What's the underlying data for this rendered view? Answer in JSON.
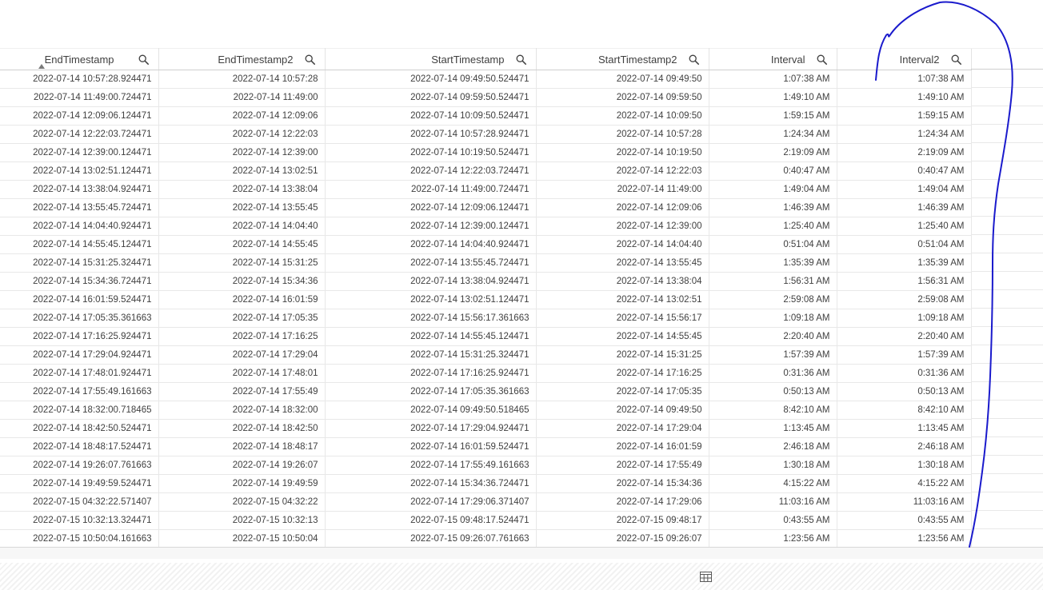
{
  "table": {
    "sort_column": "EndTimestamp",
    "sort_direction": "ascending",
    "columns": [
      {
        "label": "EndTimestamp",
        "icon": "search-icon"
      },
      {
        "label": "EndTimestamp2",
        "icon": "search-icon"
      },
      {
        "label": "StartTimestamp",
        "icon": "search-icon"
      },
      {
        "label": "StartTimestamp2",
        "icon": "search-icon"
      },
      {
        "label": "Interval",
        "icon": "search-icon"
      },
      {
        "label": "Interval2",
        "icon": "search-icon"
      }
    ],
    "rows": [
      [
        "2022-07-14 10:57:28.924471",
        "2022-07-14 10:57:28",
        "2022-07-14 09:49:50.524471",
        "2022-07-14 09:49:50",
        "1:07:38 AM",
        "1:07:38 AM"
      ],
      [
        "2022-07-14 11:49:00.724471",
        "2022-07-14 11:49:00",
        "2022-07-14 09:59:50.524471",
        "2022-07-14 09:59:50",
        "1:49:10 AM",
        "1:49:10 AM"
      ],
      [
        "2022-07-14 12:09:06.124471",
        "2022-07-14 12:09:06",
        "2022-07-14 10:09:50.524471",
        "2022-07-14 10:09:50",
        "1:59:15 AM",
        "1:59:15 AM"
      ],
      [
        "2022-07-14 12:22:03.724471",
        "2022-07-14 12:22:03",
        "2022-07-14 10:57:28.924471",
        "2022-07-14 10:57:28",
        "1:24:34 AM",
        "1:24:34 AM"
      ],
      [
        "2022-07-14 12:39:00.124471",
        "2022-07-14 12:39:00",
        "2022-07-14 10:19:50.524471",
        "2022-07-14 10:19:50",
        "2:19:09 AM",
        "2:19:09 AM"
      ],
      [
        "2022-07-14 13:02:51.124471",
        "2022-07-14 13:02:51",
        "2022-07-14 12:22:03.724471",
        "2022-07-14 12:22:03",
        "0:40:47 AM",
        "0:40:47 AM"
      ],
      [
        "2022-07-14 13:38:04.924471",
        "2022-07-14 13:38:04",
        "2022-07-14 11:49:00.724471",
        "2022-07-14 11:49:00",
        "1:49:04 AM",
        "1:49:04 AM"
      ],
      [
        "2022-07-14 13:55:45.724471",
        "2022-07-14 13:55:45",
        "2022-07-14 12:09:06.124471",
        "2022-07-14 12:09:06",
        "1:46:39 AM",
        "1:46:39 AM"
      ],
      [
        "2022-07-14 14:04:40.924471",
        "2022-07-14 14:04:40",
        "2022-07-14 12:39:00.124471",
        "2022-07-14 12:39:00",
        "1:25:40 AM",
        "1:25:40 AM"
      ],
      [
        "2022-07-14 14:55:45.124471",
        "2022-07-14 14:55:45",
        "2022-07-14 14:04:40.924471",
        "2022-07-14 14:04:40",
        "0:51:04 AM",
        "0:51:04 AM"
      ],
      [
        "2022-07-14 15:31:25.324471",
        "2022-07-14 15:31:25",
        "2022-07-14 13:55:45.724471",
        "2022-07-14 13:55:45",
        "1:35:39 AM",
        "1:35:39 AM"
      ],
      [
        "2022-07-14 15:34:36.724471",
        "2022-07-14 15:34:36",
        "2022-07-14 13:38:04.924471",
        "2022-07-14 13:38:04",
        "1:56:31 AM",
        "1:56:31 AM"
      ],
      [
        "2022-07-14 16:01:59.524471",
        "2022-07-14 16:01:59",
        "2022-07-14 13:02:51.124471",
        "2022-07-14 13:02:51",
        "2:59:08 AM",
        "2:59:08 AM"
      ],
      [
        "2022-07-14 17:05:35.361663",
        "2022-07-14 17:05:35",
        "2022-07-14 15:56:17.361663",
        "2022-07-14 15:56:17",
        "1:09:18 AM",
        "1:09:18 AM"
      ],
      [
        "2022-07-14 17:16:25.924471",
        "2022-07-14 17:16:25",
        "2022-07-14 14:55:45.124471",
        "2022-07-14 14:55:45",
        "2:20:40 AM",
        "2:20:40 AM"
      ],
      [
        "2022-07-14 17:29:04.924471",
        "2022-07-14 17:29:04",
        "2022-07-14 15:31:25.324471",
        "2022-07-14 15:31:25",
        "1:57:39 AM",
        "1:57:39 AM"
      ],
      [
        "2022-07-14 17:48:01.924471",
        "2022-07-14 17:48:01",
        "2022-07-14 17:16:25.924471",
        "2022-07-14 17:16:25",
        "0:31:36 AM",
        "0:31:36 AM"
      ],
      [
        "2022-07-14 17:55:49.161663",
        "2022-07-14 17:55:49",
        "2022-07-14 17:05:35.361663",
        "2022-07-14 17:05:35",
        "0:50:13 AM",
        "0:50:13 AM"
      ],
      [
        "2022-07-14 18:32:00.718465",
        "2022-07-14 18:32:00",
        "2022-07-14 09:49:50.518465",
        "2022-07-14 09:49:50",
        "8:42:10 AM",
        "8:42:10 AM"
      ],
      [
        "2022-07-14 18:42:50.524471",
        "2022-07-14 18:42:50",
        "2022-07-14 17:29:04.924471",
        "2022-07-14 17:29:04",
        "1:13:45 AM",
        "1:13:45 AM"
      ],
      [
        "2022-07-14 18:48:17.524471",
        "2022-07-14 18:48:17",
        "2022-07-14 16:01:59.524471",
        "2022-07-14 16:01:59",
        "2:46:18 AM",
        "2:46:18 AM"
      ],
      [
        "2022-07-14 19:26:07.761663",
        "2022-07-14 19:26:07",
        "2022-07-14 17:55:49.161663",
        "2022-07-14 17:55:49",
        "1:30:18 AM",
        "1:30:18 AM"
      ],
      [
        "2022-07-14 19:49:59.524471",
        "2022-07-14 19:49:59",
        "2022-07-14 15:34:36.724471",
        "2022-07-14 15:34:36",
        "4:15:22 AM",
        "4:15:22 AM"
      ],
      [
        "2022-07-15 04:32:22.571407",
        "2022-07-15 04:32:22",
        "2022-07-14 17:29:06.371407",
        "2022-07-14 17:29:06",
        "11:03:16 AM",
        "11:03:16 AM"
      ],
      [
        "2022-07-15 10:32:13.324471",
        "2022-07-15 10:32:13",
        "2022-07-15 09:48:17.524471",
        "2022-07-15 09:48:17",
        "0:43:55 AM",
        "0:43:55 AM"
      ],
      [
        "2022-07-15 10:50:04.161663",
        "2022-07-15 10:50:04",
        "2022-07-15 09:26:07.761663",
        "2022-07-15 09:26:07",
        "1:23:56 AM",
        "1:23:56 AM"
      ]
    ]
  },
  "footer": {
    "icon": "table-view-icon"
  },
  "annotation": {
    "color": "#1a1acc",
    "shape": "hand-drawn-bracket"
  }
}
